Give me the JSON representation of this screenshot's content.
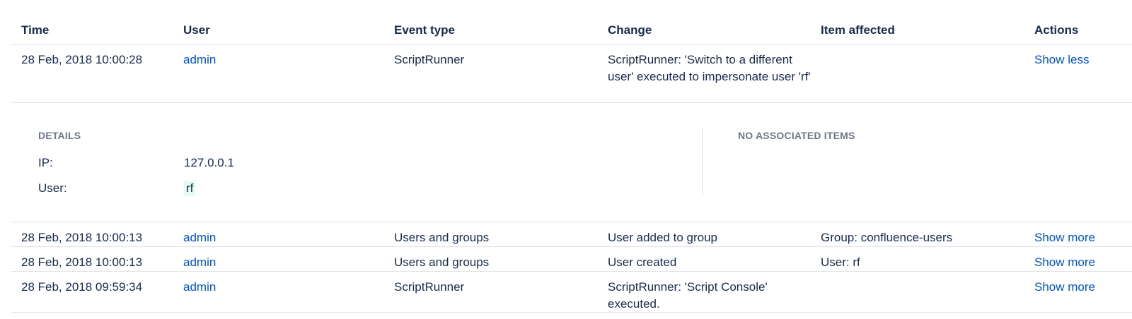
{
  "columns": {
    "time": "Time",
    "user": "User",
    "event_type": "Event type",
    "change": "Change",
    "item_affected": "Item affected",
    "actions": "Actions"
  },
  "rows": [
    {
      "time": "28 Feb, 2018 10:00:28",
      "user": "admin",
      "event_type": "ScriptRunner",
      "change": "ScriptRunner: 'Switch to a different user' executed to impersonate user 'rf'",
      "item_affected": "",
      "action": "Show less"
    },
    {
      "time": "28 Feb, 2018 10:00:13",
      "user": "admin",
      "event_type": "Users and groups",
      "change": "User added to group",
      "item_affected": "Group: confluence-users",
      "action": "Show more"
    },
    {
      "time": "28 Feb, 2018 10:00:13",
      "user": "admin",
      "event_type": "Users and groups",
      "change": "User created",
      "item_affected": "User: rf",
      "action": "Show more"
    },
    {
      "time": "28 Feb, 2018 09:59:34",
      "user": "admin",
      "event_type": "ScriptRunner",
      "change": "ScriptRunner: 'Script Console' executed.",
      "item_affected": "",
      "action": "Show more"
    }
  ],
  "details": {
    "heading": "DETAILS",
    "ip_label": "IP:",
    "ip_value": "127.0.0.1",
    "user_label": "User:",
    "user_value": "rf",
    "associated_heading": "NO ASSOCIATED ITEMS"
  },
  "colors": {
    "link": "#0052cc",
    "text": "#172b4d",
    "muted": "#6b778c",
    "divider": "#dfe1e6",
    "highlight": "#e3fcef"
  }
}
